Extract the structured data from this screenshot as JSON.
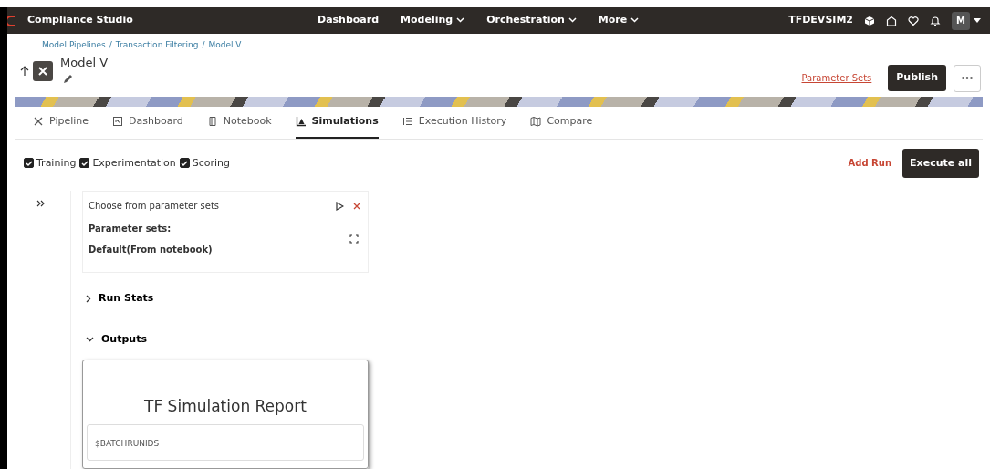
{
  "header": {
    "brand": "Compliance Studio",
    "nav": [
      {
        "label": "Dashboard",
        "dropdown": false
      },
      {
        "label": "Modeling",
        "dropdown": true
      },
      {
        "label": "Orchestration",
        "dropdown": true
      },
      {
        "label": "More",
        "dropdown": true
      }
    ],
    "user": "TFDEVSIM2",
    "avatar": "M"
  },
  "breadcrumb": {
    "items": [
      "Model Pipelines",
      "Transaction Filtering",
      "Model V"
    ],
    "separators": [
      "/",
      "/"
    ]
  },
  "title": "Model V",
  "actions": {
    "link": "Parameter Sets",
    "primary": "Publish"
  },
  "tabs": [
    {
      "label": "Pipeline",
      "selected": false
    },
    {
      "label": "Dashboard",
      "selected": false
    },
    {
      "label": "Notebook",
      "selected": false
    },
    {
      "label": "Simulations",
      "selected": true
    },
    {
      "label": "Execution History",
      "selected": false
    },
    {
      "label": "Compare",
      "selected": false
    }
  ],
  "run_types": [
    {
      "label": "Training",
      "checked": true
    },
    {
      "label": "Experimentation",
      "checked": true
    },
    {
      "label": "Scoring",
      "checked": true
    }
  ],
  "toolbar": {
    "link": "Add Run",
    "button": "Execute all"
  },
  "run": {
    "link": "Choose from parameter sets",
    "label": "Parameter sets:",
    "value": "Default(From notebook)",
    "sections": [
      {
        "label": "Run Stats",
        "expanded": false
      },
      {
        "label": "Outputs",
        "expanded": true
      }
    ],
    "report": {
      "title": "TF Simulation Report",
      "field": "$BATCHRUNIDS"
    }
  }
}
